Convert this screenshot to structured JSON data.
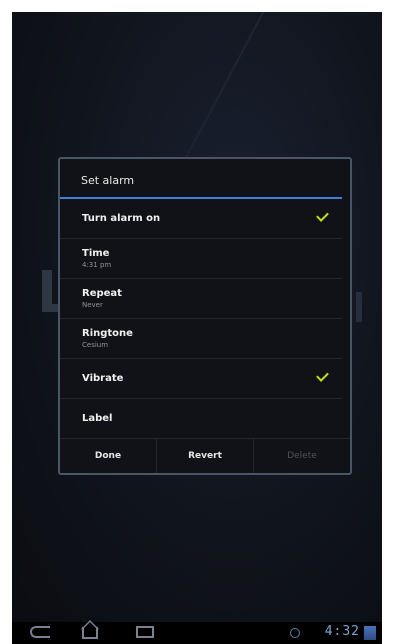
{
  "dialog": {
    "title": "Set alarm",
    "rows": [
      {
        "label": "Turn alarm on",
        "checked": true
      },
      {
        "label": "Time",
        "value": "4:31 pm"
      },
      {
        "label": "Repeat",
        "value": "Never"
      },
      {
        "label": "Ringtone",
        "value": "Cesium"
      },
      {
        "label": "Vibrate",
        "checked": true
      },
      {
        "label": "Label"
      }
    ],
    "buttons": {
      "done": "Done",
      "revert": "Revert",
      "delete": "Delete"
    }
  },
  "status_bar": {
    "clock": "4:32"
  },
  "colors": {
    "accent": "#3f7fd6",
    "check": "#b8e60d",
    "dialog_bg": "#101217"
  },
  "icons": [
    "back-icon",
    "home-icon",
    "recent-apps-icon",
    "gps-icon",
    "signal-icon",
    "checkmark-icon"
  ]
}
